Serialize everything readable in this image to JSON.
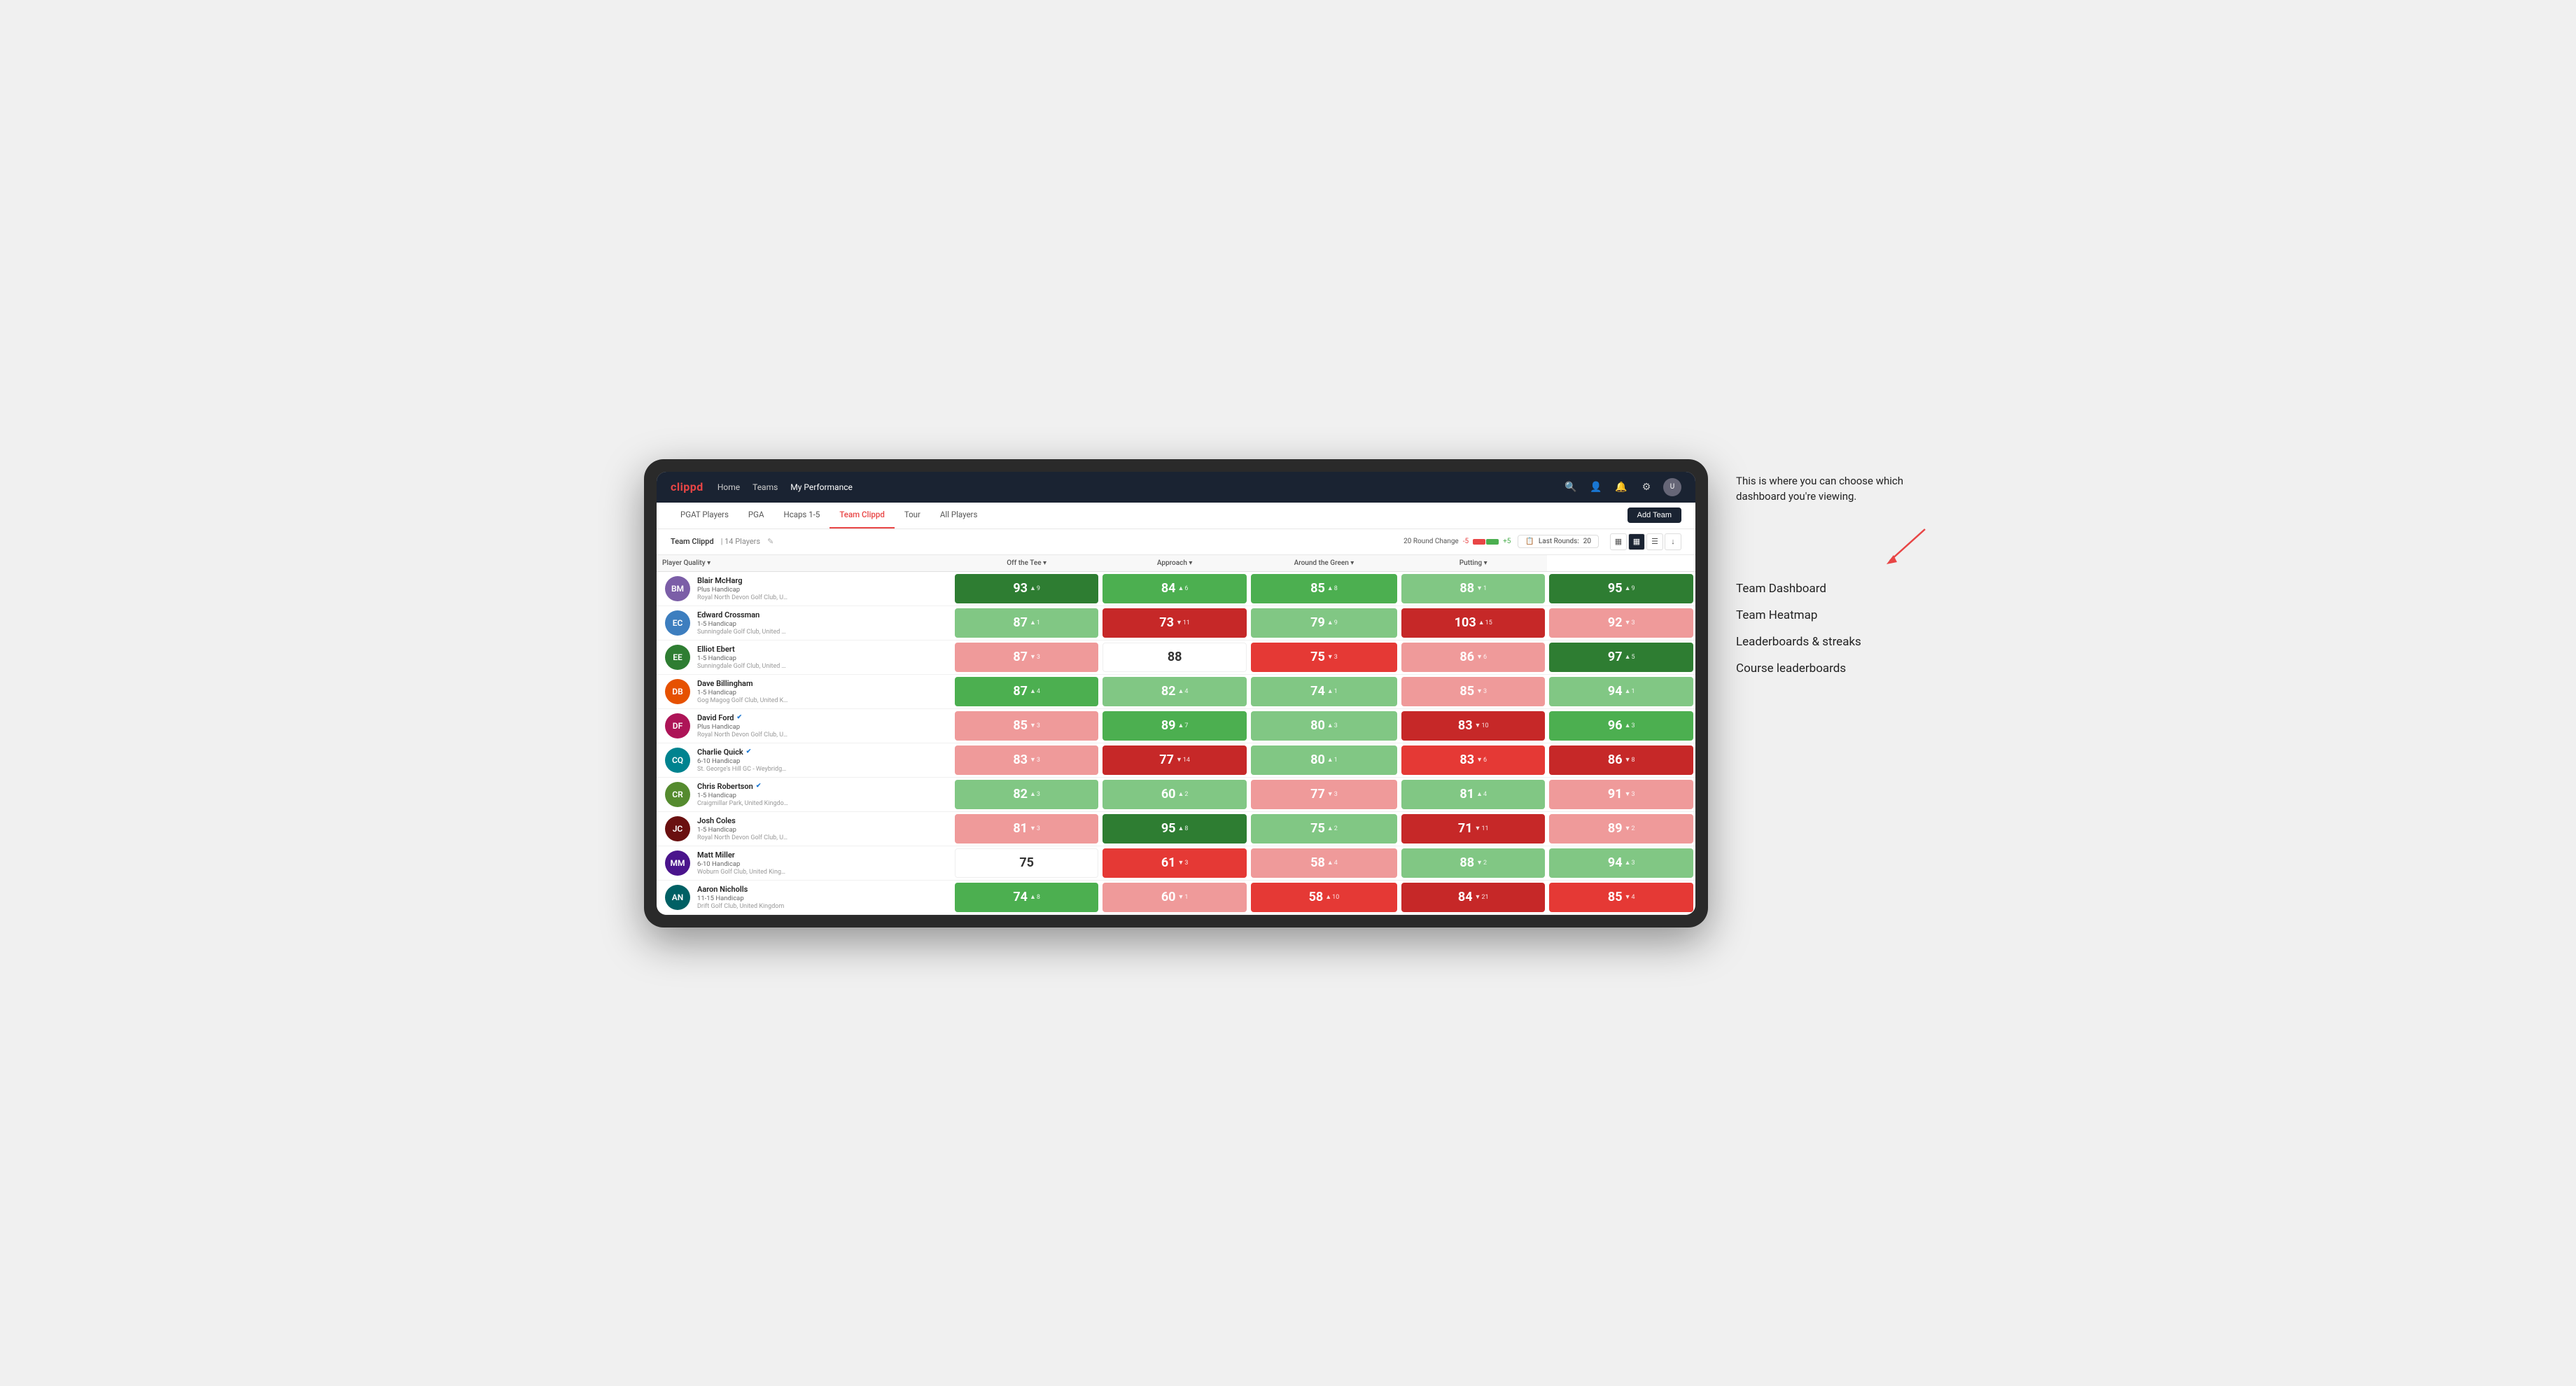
{
  "annotation": {
    "intro_text": "This is where you can choose which dashboard you're viewing.",
    "options": [
      "Team Dashboard",
      "Team Heatmap",
      "Leaderboards & streaks",
      "Course leaderboards"
    ]
  },
  "nav": {
    "logo": "clippd",
    "links": [
      "Home",
      "Teams",
      "My Performance"
    ],
    "active_link": "My Performance"
  },
  "sub_nav": {
    "links": [
      "PGAT Players",
      "PGA",
      "Hcaps 1-5",
      "Team Clippd",
      "Tour",
      "All Players"
    ],
    "active_link": "Team Clippd",
    "add_team_label": "Add Team"
  },
  "toolbar": {
    "team_name": "Team Clippd",
    "separator": "|",
    "player_count": "14 Players",
    "round_change_label": "20 Round Change",
    "round_change_neg": "-5",
    "round_change_pos": "+5",
    "last_rounds_label": "Last Rounds:",
    "last_rounds_value": "20"
  },
  "table": {
    "headers": {
      "player": "Player Quality ▾",
      "off_tee": "Off the Tee ▾",
      "approach": "Approach ▾",
      "around_green": "Around the Green ▾",
      "putting": "Putting ▾"
    },
    "players": [
      {
        "name": "Blair McHarg",
        "handicap": "Plus Handicap",
        "club": "Royal North Devon Golf Club, United Kingdom",
        "initials": "BM",
        "av_class": "av-1",
        "scores": [
          {
            "val": "93",
            "change": "9",
            "dir": "up",
            "bg": "bg-green-dark"
          },
          {
            "val": "84",
            "change": "6",
            "dir": "up",
            "bg": "bg-green-mid"
          },
          {
            "val": "85",
            "change": "8",
            "dir": "up",
            "bg": "bg-green-mid"
          },
          {
            "val": "88",
            "change": "1",
            "dir": "down",
            "bg": "bg-green-light"
          },
          {
            "val": "95",
            "change": "9",
            "dir": "up",
            "bg": "bg-green-dark"
          }
        ]
      },
      {
        "name": "Edward Crossman",
        "handicap": "1-5 Handicap",
        "club": "Sunningdale Golf Club, United Kingdom",
        "initials": "EC",
        "av_class": "av-2",
        "scores": [
          {
            "val": "87",
            "change": "1",
            "dir": "up",
            "bg": "bg-green-light"
          },
          {
            "val": "73",
            "change": "11",
            "dir": "down",
            "bg": "bg-red-dark"
          },
          {
            "val": "79",
            "change": "9",
            "dir": "up",
            "bg": "bg-green-light"
          },
          {
            "val": "103",
            "change": "15",
            "dir": "up",
            "bg": "bg-red-dark"
          },
          {
            "val": "92",
            "change": "3",
            "dir": "down",
            "bg": "bg-red-light"
          }
        ]
      },
      {
        "name": "Elliot Ebert",
        "handicap": "1-5 Handicap",
        "club": "Sunningdale Golf Club, United Kingdom",
        "initials": "EE",
        "av_class": "av-3",
        "scores": [
          {
            "val": "87",
            "change": "3",
            "dir": "down",
            "bg": "bg-red-light"
          },
          {
            "val": "88",
            "change": "",
            "dir": "",
            "bg": "bg-white"
          },
          {
            "val": "75",
            "change": "3",
            "dir": "down",
            "bg": "bg-red-mid"
          },
          {
            "val": "86",
            "change": "6",
            "dir": "down",
            "bg": "bg-red-light"
          },
          {
            "val": "97",
            "change": "5",
            "dir": "up",
            "bg": "bg-green-dark"
          }
        ]
      },
      {
        "name": "Dave Billingham",
        "handicap": "1-5 Handicap",
        "club": "Gog Magog Golf Club, United Kingdom",
        "initials": "DB",
        "av_class": "av-4",
        "scores": [
          {
            "val": "87",
            "change": "4",
            "dir": "up",
            "bg": "bg-green-mid"
          },
          {
            "val": "82",
            "change": "4",
            "dir": "up",
            "bg": "bg-green-light"
          },
          {
            "val": "74",
            "change": "1",
            "dir": "up",
            "bg": "bg-green-light"
          },
          {
            "val": "85",
            "change": "3",
            "dir": "down",
            "bg": "bg-red-light"
          },
          {
            "val": "94",
            "change": "1",
            "dir": "up",
            "bg": "bg-green-light"
          }
        ]
      },
      {
        "name": "David Ford",
        "handicap": "Plus Handicap",
        "club": "Royal North Devon Golf Club, United Kingdom",
        "initials": "DF",
        "av_class": "av-5",
        "verified": true,
        "scores": [
          {
            "val": "85",
            "change": "3",
            "dir": "down",
            "bg": "bg-red-light"
          },
          {
            "val": "89",
            "change": "7",
            "dir": "up",
            "bg": "bg-green-mid"
          },
          {
            "val": "80",
            "change": "3",
            "dir": "up",
            "bg": "bg-green-light"
          },
          {
            "val": "83",
            "change": "10",
            "dir": "down",
            "bg": "bg-red-dark"
          },
          {
            "val": "96",
            "change": "3",
            "dir": "up",
            "bg": "bg-green-mid"
          }
        ]
      },
      {
        "name": "Charlie Quick",
        "handicap": "6-10 Handicap",
        "club": "St. George's Hill GC - Weybridge - Surrey, Uni...",
        "initials": "CQ",
        "av_class": "av-6",
        "verified": true,
        "scores": [
          {
            "val": "83",
            "change": "3",
            "dir": "down",
            "bg": "bg-red-light"
          },
          {
            "val": "77",
            "change": "14",
            "dir": "down",
            "bg": "bg-red-dark"
          },
          {
            "val": "80",
            "change": "1",
            "dir": "up",
            "bg": "bg-green-light"
          },
          {
            "val": "83",
            "change": "6",
            "dir": "down",
            "bg": "bg-red-mid"
          },
          {
            "val": "86",
            "change": "8",
            "dir": "down",
            "bg": "bg-red-dark"
          }
        ]
      },
      {
        "name": "Chris Robertson",
        "handicap": "1-5 Handicap",
        "club": "Craigmillar Park, United Kingdom",
        "initials": "CR",
        "av_class": "av-7",
        "verified": true,
        "scores": [
          {
            "val": "82",
            "change": "3",
            "dir": "up",
            "bg": "bg-green-light"
          },
          {
            "val": "60",
            "change": "2",
            "dir": "up",
            "bg": "bg-green-light"
          },
          {
            "val": "77",
            "change": "3",
            "dir": "down",
            "bg": "bg-red-light"
          },
          {
            "val": "81",
            "change": "4",
            "dir": "up",
            "bg": "bg-green-light"
          },
          {
            "val": "91",
            "change": "3",
            "dir": "down",
            "bg": "bg-red-light"
          }
        ]
      },
      {
        "name": "Josh Coles",
        "handicap": "1-5 Handicap",
        "club": "Royal North Devon Golf Club, United Kingdom",
        "initials": "JC",
        "av_class": "av-8",
        "scores": [
          {
            "val": "81",
            "change": "3",
            "dir": "down",
            "bg": "bg-red-light"
          },
          {
            "val": "95",
            "change": "8",
            "dir": "up",
            "bg": "bg-green-dark"
          },
          {
            "val": "75",
            "change": "2",
            "dir": "up",
            "bg": "bg-green-light"
          },
          {
            "val": "71",
            "change": "11",
            "dir": "down",
            "bg": "bg-red-dark"
          },
          {
            "val": "89",
            "change": "2",
            "dir": "down",
            "bg": "bg-red-light"
          }
        ]
      },
      {
        "name": "Matt Miller",
        "handicap": "6-10 Handicap",
        "club": "Woburn Golf Club, United Kingdom",
        "initials": "MM",
        "av_class": "av-9",
        "scores": [
          {
            "val": "75",
            "change": "",
            "dir": "",
            "bg": "bg-white"
          },
          {
            "val": "61",
            "change": "3",
            "dir": "down",
            "bg": "bg-red-mid"
          },
          {
            "val": "58",
            "change": "4",
            "dir": "up",
            "bg": "bg-red-light"
          },
          {
            "val": "88",
            "change": "2",
            "dir": "down",
            "bg": "bg-green-light"
          },
          {
            "val": "94",
            "change": "3",
            "dir": "up",
            "bg": "bg-green-light"
          }
        ]
      },
      {
        "name": "Aaron Nicholls",
        "handicap": "11-15 Handicap",
        "club": "Drift Golf Club, United Kingdom",
        "initials": "AN",
        "av_class": "av-10",
        "scores": [
          {
            "val": "74",
            "change": "8",
            "dir": "up",
            "bg": "bg-green-mid"
          },
          {
            "val": "60",
            "change": "1",
            "dir": "down",
            "bg": "bg-red-light"
          },
          {
            "val": "58",
            "change": "10",
            "dir": "up",
            "bg": "bg-red-mid"
          },
          {
            "val": "84",
            "change": "21",
            "dir": "down",
            "bg": "bg-red-dark"
          },
          {
            "val": "85",
            "change": "4",
            "dir": "down",
            "bg": "bg-red-mid"
          }
        ]
      }
    ]
  }
}
